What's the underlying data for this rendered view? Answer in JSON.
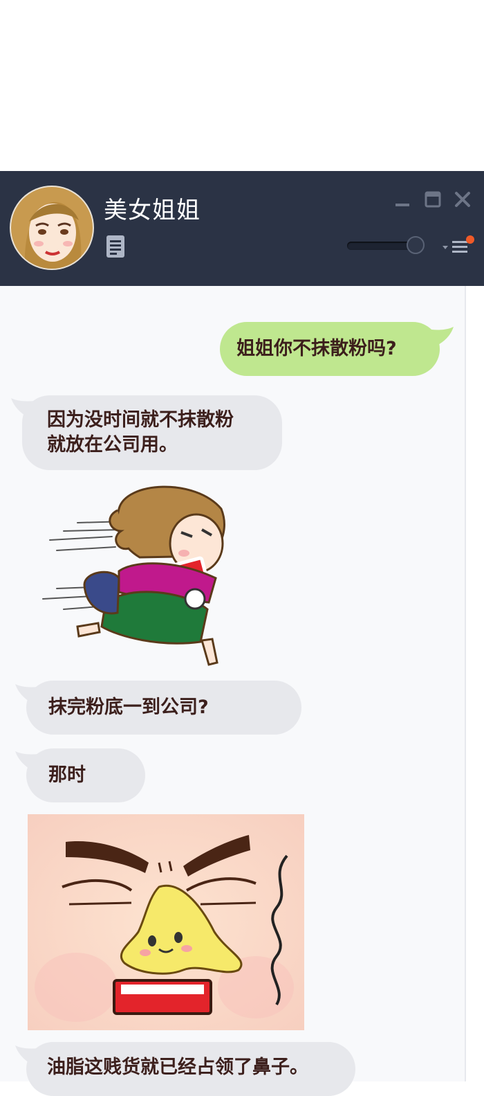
{
  "window": {
    "contact_name": "美女姐姐",
    "icons": {
      "avatar": "contact-avatar-woman",
      "document": "document-icon",
      "minimize": "minimize-icon",
      "maximize": "maximize-icon",
      "close": "close-icon",
      "volume_slider": "volume-slider",
      "menu": "menu-dropdown-icon"
    },
    "slider_level": 0.9,
    "colors": {
      "titlebar": "#2b3345",
      "me_bubble": "#bfe78f",
      "them_bubble": "#e7e8ec",
      "notify_dot": "#f05a28"
    }
  },
  "messages": [
    {
      "from": "me",
      "text": "姐姐你不抹散粉吗?"
    },
    {
      "from": "them",
      "lines": [
        "因为没时间就不抹散粉",
        "就放在公司用。"
      ]
    },
    {
      "from": "them",
      "type": "sticker",
      "icon": "running-girl-sticker"
    },
    {
      "from": "them",
      "text": "抹完粉底一到公司?"
    },
    {
      "from": "them",
      "text": "那时"
    },
    {
      "from": "them",
      "type": "image",
      "icon": "oily-nose-face-image"
    },
    {
      "from": "them",
      "text": "油脂这贱货就已经占领了鼻子。"
    }
  ]
}
